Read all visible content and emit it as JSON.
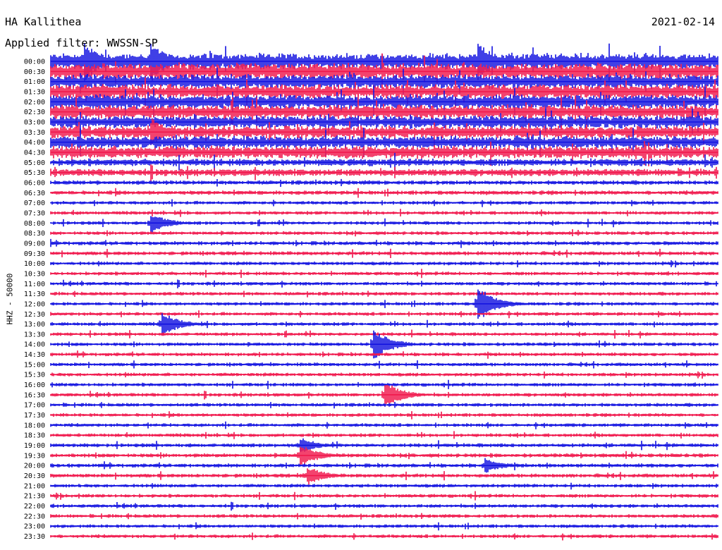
{
  "header": {
    "station": "HA Kallithea",
    "date": "2021-02-14",
    "filter": "Applied filter: WWSSN-SP"
  },
  "chart_data": {
    "type": "line",
    "description_text": "",
    "ylabel": "HHZ - 50000",
    "row_labels": [
      "00:00",
      "00:30",
      "01:00",
      "01:30",
      "02:00",
      "02:30",
      "03:00",
      "03:30",
      "04:00",
      "04:30",
      "05:00",
      "05:30",
      "06:00",
      "06:30",
      "07:00",
      "07:30",
      "08:00",
      "08:30",
      "09:00",
      "09:30",
      "10:00",
      "10:30",
      "11:00",
      "11:30",
      "12:00",
      "12:30",
      "13:00",
      "13:30",
      "14:00",
      "14:30",
      "15:00",
      "15:30",
      "16:00",
      "16:30",
      "17:00",
      "17:30",
      "18:00",
      "18:30",
      "19:00",
      "19:30",
      "20:00",
      "20:30",
      "21:00",
      "21:30",
      "22:00",
      "22:30",
      "23:00",
      "23:30"
    ],
    "row_duration_minutes": 30,
    "colors": [
      "#1010e0",
      "#f0144a"
    ],
    "noise_level_by_hour": [
      4.5,
      4.0,
      4.0,
      3.5,
      3.5,
      2.0,
      1.2,
      1.0,
      1.0,
      1.1,
      1.0,
      1.0,
      1.0,
      1.0,
      1.0,
      1.0,
      1.0,
      1.0,
      1.0,
      1.1,
      1.1,
      1.0,
      1.0,
      1.0
    ],
    "events": [
      {
        "row": 0,
        "minute": 1.5,
        "amplitude": 10
      },
      {
        "row": 0,
        "minute": 4.5,
        "amplitude": 10
      },
      {
        "row": 0,
        "minute": 19.2,
        "amplitude": 10
      },
      {
        "row": 7,
        "minute": 4.5,
        "amplitude": 7
      },
      {
        "row": 16,
        "minute": 4.5,
        "amplitude": 5
      },
      {
        "row": 24,
        "minute": 19.2,
        "amplitude": 9
      },
      {
        "row": 26,
        "minute": 5.0,
        "amplitude": 6
      },
      {
        "row": 28,
        "minute": 14.5,
        "amplitude": 8
      },
      {
        "row": 33,
        "minute": 15.0,
        "amplitude": 7
      },
      {
        "row": 38,
        "minute": 11.2,
        "amplitude": 4
      },
      {
        "row": 39,
        "minute": 11.2,
        "amplitude": 6
      },
      {
        "row": 40,
        "minute": 19.5,
        "amplitude": 4
      },
      {
        "row": 41,
        "minute": 11.5,
        "amplitude": 5
      }
    ]
  }
}
